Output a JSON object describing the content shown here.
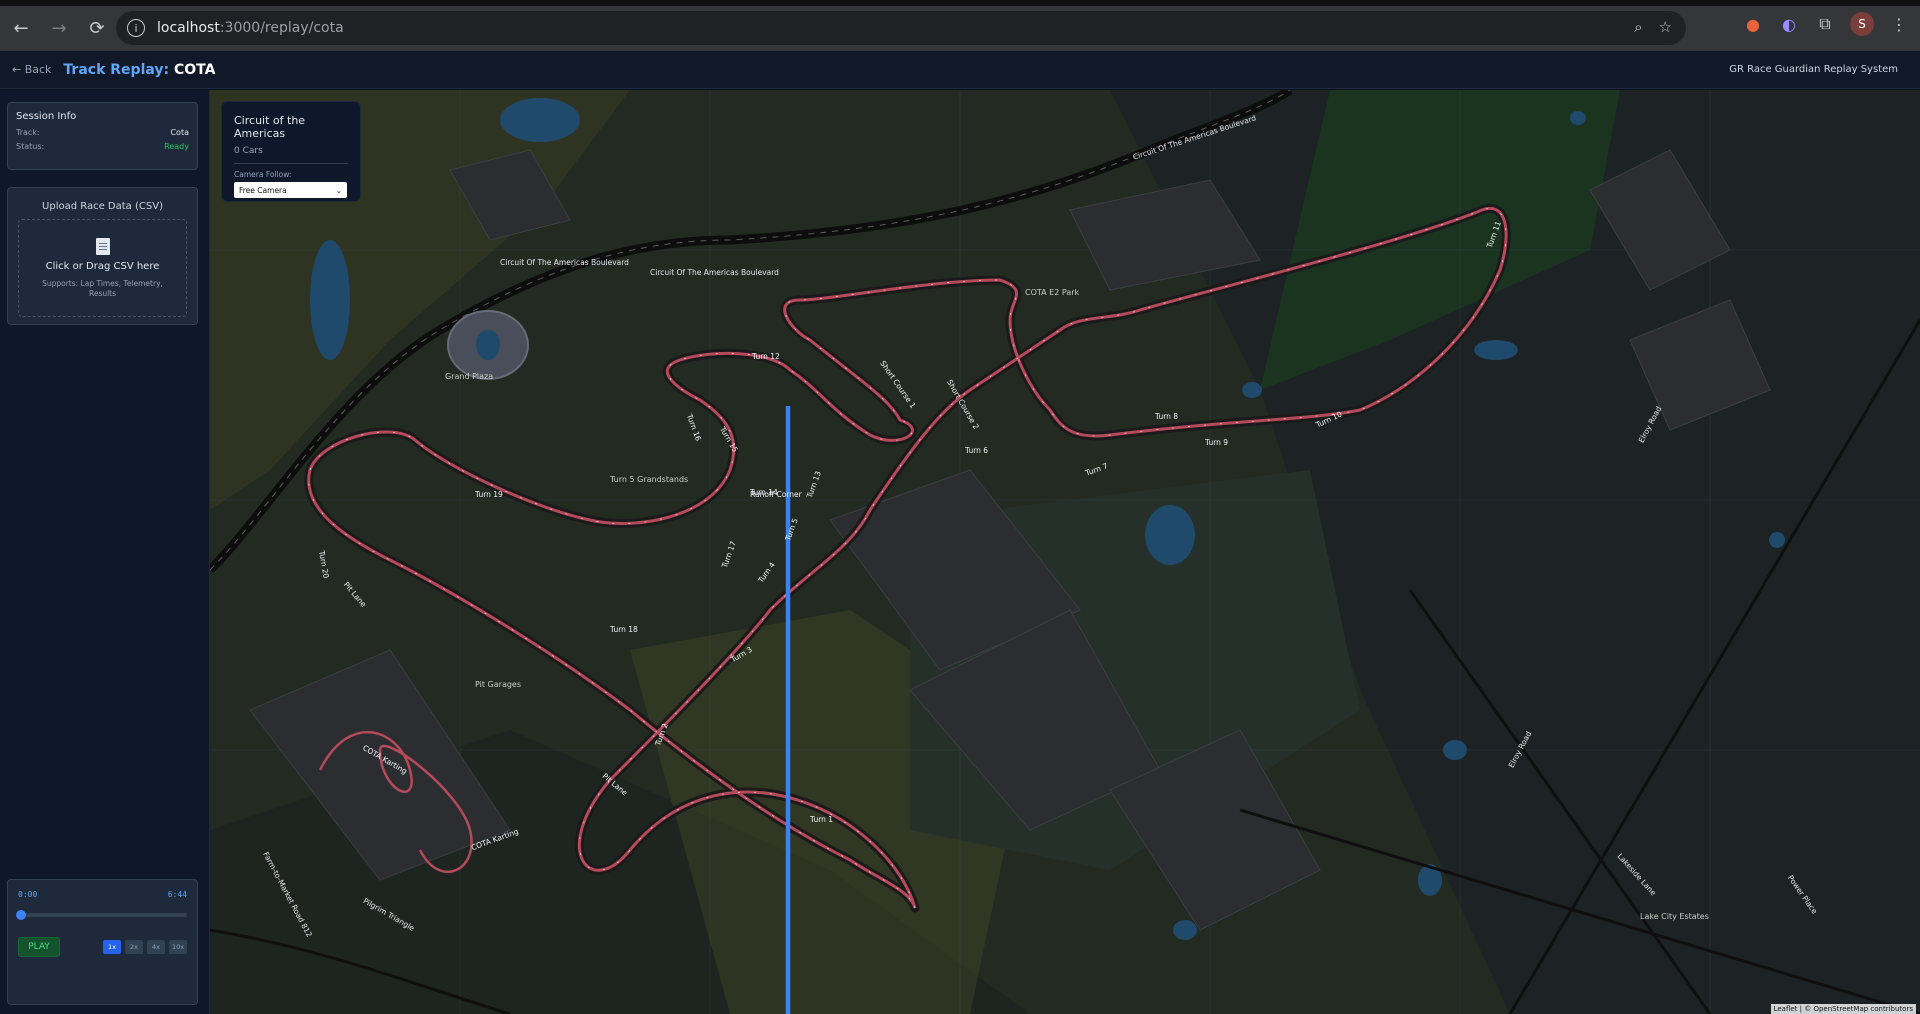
{
  "browser": {
    "url_host": "localhost",
    "url_rest": ":3000/replay/cota",
    "profile_initial": "S"
  },
  "header": {
    "back_label": "← Back",
    "title_prefix": "Track Replay:",
    "title_track": "COTA",
    "system_name": "GR Race Guardian Replay System"
  },
  "session": {
    "title": "Session Info",
    "track_label": "Track:",
    "track_value": "Cota",
    "status_label": "Status:",
    "status_value": "Ready"
  },
  "upload": {
    "title": "Upload Race Data (CSV)",
    "drop_text": "Click or Drag CSV here",
    "supports_text": "Supports: Lap Times, Telemetry, Results"
  },
  "player": {
    "current_time": "0:00",
    "total_time": "6:44",
    "progress": 0,
    "play_label": "PLAY",
    "speeds": [
      "1x",
      "2x",
      "4x",
      "10x"
    ],
    "active_speed": "1x"
  },
  "overlay": {
    "title": "Circuit of the Americas",
    "cars": "0 Cars",
    "camera_label": "Camera Follow:",
    "camera_value": "Free Camera"
  },
  "map": {
    "attribution": "Leaflet | © OpenStreetMap contributors",
    "turns": [
      "Turn 1",
      "Turn 2",
      "Turn 3",
      "Turn 4",
      "Turn 5",
      "Turn 6",
      "Turn 7",
      "Turn 8",
      "Turn 9",
      "Turn 10",
      "Turn 11",
      "Turn 12",
      "Turn 13",
      "Turn 14",
      "Turn 15",
      "Turn 16",
      "Turn 17",
      "Turn 18",
      "Turn 19",
      "Turn 20"
    ],
    "labels": {
      "grand_plaza": "Grand Plaza",
      "grandstands": "Turn 5 Grandstands",
      "pit_garages": "Pit Garages",
      "pit_lane": "Pit Lane",
      "short_course_1": "Short Course 1",
      "short_course_2": "Short Course 2",
      "runoff_corner": "Runoff Corner",
      "cota_karting": "COTA Karting",
      "lot_e": "COTA E2 Park",
      "boulevard": "Circuit Of The Americas Boulevard",
      "elroy_road": "Elroy Road",
      "pilgrim": "Pilgrim Triangle",
      "farm_road": "Farm-to-Market Road 812",
      "lake_city": "Lake City Estates",
      "lakeside": "Lakeside Lane",
      "power_place": "Power Place"
    }
  },
  "colors": {
    "accent": "#60a5fa",
    "ready": "#22c55e",
    "track": "#b44a5a",
    "blue_line": "#3b82f6"
  }
}
